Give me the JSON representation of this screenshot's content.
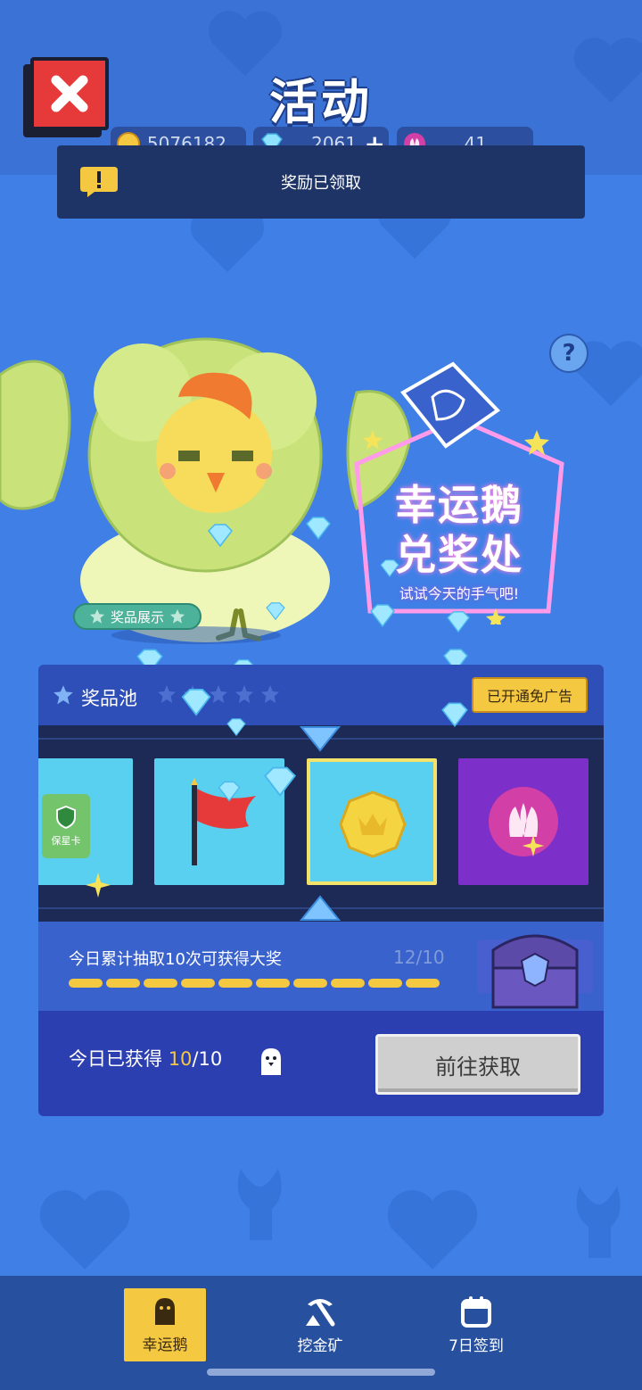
{
  "header": {
    "title": "活动",
    "currencies": [
      {
        "name": "coin",
        "value": "5076182",
        "icon": "coin-icon"
      },
      {
        "name": "gem",
        "value": "2061",
        "icon": "gem-icon",
        "add_label": "+"
      },
      {
        "name": "lotus",
        "value": "41",
        "icon": "lotus-icon"
      }
    ]
  },
  "notice": {
    "text": "奖励已领取",
    "icon": "alert-icon"
  },
  "hero": {
    "prize_show_label": "奖品展示",
    "help_label": "?",
    "sign_line1": "幸运鹅",
    "sign_line2": "兑奖处",
    "sign_sub": "试试今天的手气吧!"
  },
  "pool": {
    "title": "奖品池",
    "ad_badge": "已开通免广告",
    "tiles": [
      {
        "name": "star-protection-card",
        "label": "保星卡",
        "icon": "shield-icon"
      },
      {
        "name": "red-flag",
        "icon": "flag-icon"
      },
      {
        "name": "gold-coin",
        "icon": "coin-icon",
        "selected": true
      },
      {
        "name": "lotus",
        "icon": "lotus-icon"
      }
    ],
    "progress_label": "今日累计抽取10次可获得大奖",
    "progress_count": "12/10",
    "progress_fraction": 1.0,
    "segments": 10,
    "obtained_label": "今日已获得",
    "obtained_current": "10",
    "obtained_total": "/10",
    "go_button": "前往获取"
  },
  "nav": {
    "items": [
      {
        "label": "幸运鹅",
        "icon": "goose-icon",
        "active": true
      },
      {
        "label": "挖金矿",
        "icon": "pickaxe-icon",
        "active": false
      },
      {
        "label": "7日签到",
        "icon": "calendar-icon",
        "active": false
      }
    ]
  },
  "colors": {
    "background": "#3f7fe6",
    "accent": "#f5c842",
    "panel": "#2f4fb8"
  }
}
